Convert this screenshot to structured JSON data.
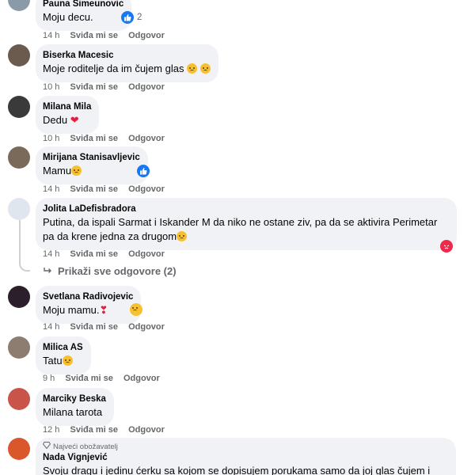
{
  "actions": {
    "like": "Sviđa mi se",
    "reply": "Odgovor"
  },
  "comments": [
    {
      "author": "Pauna Simeunovic",
      "text": "Moju decu.",
      "time": "14 h",
      "reactions": "2"
    },
    {
      "author": "Biserka Macesic",
      "text": "Moje roditelje da im čujem glas",
      "time": "10 h"
    },
    {
      "author": "Milana Mila",
      "text": "Dedu",
      "time": "10 h"
    },
    {
      "author": "Mirijana Stanisavljevic",
      "text": "Mamu",
      "time": "14 h"
    },
    {
      "author": "Jolita LaDefisbradora",
      "text": "Putina, da ispali Sarmat i Iskander M da niko ne ostane ziv, pa da se aktivira Perimetar pa da krene jedna za drugom",
      "time": "14 h"
    },
    {
      "author": "Svetlana Radivojevic",
      "text": "Moju mamu.",
      "time": "14 h"
    },
    {
      "author": "Milica AS",
      "text": "Tatu",
      "time": "9 h"
    },
    {
      "author": "Marciky Beska",
      "text": "Milana tarota",
      "time": "12 h"
    },
    {
      "author": "Nada Vignjević",
      "badge": "Najveći obožavatelj",
      "text": "Svoju dragu i jedinu ćerku sa kojom se dopisujem porukama samo da joj glas čujem i"
    }
  ],
  "more_replies": "Prikaži sve odgovore (2)",
  "colors": {
    "bubble": "#f0f2f5",
    "meta": "#65676b",
    "like": "#1877f2",
    "angry": "#f02849"
  }
}
